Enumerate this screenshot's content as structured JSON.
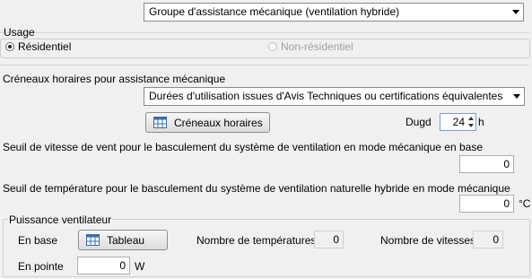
{
  "group_combo": {
    "value": "Groupe d'assistance mécanique (ventilation hybride)"
  },
  "usage": {
    "title": "Usage",
    "residential": "Résidentiel",
    "non_residential": "Non-résidentiel"
  },
  "schedules": {
    "title": "Créneaux horaires pour assistance mécanique",
    "source_value": "Durées d'utilisation issues d'Avis Techniques ou certifications équivalentes",
    "button_label": "Créneaux horaires",
    "dugd_label": "Dugd",
    "dugd_value": "24",
    "dugd_unit": "h"
  },
  "wind": {
    "label": "Seuil de vitesse de vent pour le basculement du système de ventilation en mode mécanique en base",
    "value": "0"
  },
  "temperature": {
    "label": "Seuil de température pour le basculement du système de ventilation naturelle hybride en mode mécanique",
    "value": "0",
    "unit": "°C"
  },
  "fan_power": {
    "title": "Puissance ventilateur",
    "base_label": "En base",
    "table_button": "Tableau",
    "num_temperatures_label": "Nombre de températures",
    "num_temperatures_value": "0",
    "num_speeds_label": "Nombre de vitesses",
    "num_speeds_value": "0",
    "peak_label": "En pointe",
    "peak_value": "0",
    "peak_unit": "W"
  }
}
